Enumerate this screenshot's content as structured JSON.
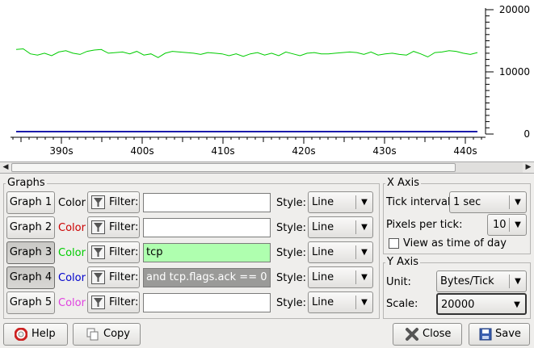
{
  "plot": {
    "y_ticks": [
      "20000",
      "10000",
      "0"
    ],
    "x_ticks": [
      "390s",
      "400s",
      "410s",
      "420s",
      "430s",
      "440s"
    ],
    "series_color": "#00cc00",
    "baseline_color": "#1a1aaa",
    "series_values": [
      13600,
      13700,
      12900,
      12700,
      13000,
      12600,
      13200,
      13400,
      13000,
      12800,
      13300,
      13500,
      13600,
      13000,
      13100,
      13200,
      12900,
      13300,
      12700,
      12900,
      12300,
      13000,
      13300,
      13200,
      13100,
      13000,
      12800,
      13100,
      13000,
      12900,
      12600,
      12900,
      12500,
      12900,
      13100,
      12700,
      13000,
      12600,
      13200,
      12900,
      12600,
      13000,
      13100,
      12900,
      12900,
      13000,
      13100,
      13200,
      13100,
      12800,
      13200,
      12700,
      12900,
      13000,
      12800,
      12700,
      13300,
      12900,
      12400,
      13100,
      13200,
      13400,
      13300,
      13000,
      12800,
      13100
    ]
  },
  "graphs": {
    "title": "Graphs",
    "color_label": "Color",
    "filter_label": "Filter:",
    "style_label": "Style:",
    "rows": [
      {
        "name": "Graph 1",
        "color": "",
        "color_hex": "#000000",
        "filter": "",
        "style": "Line",
        "pressed": false,
        "field": "plain"
      },
      {
        "name": "Graph 2",
        "color": "",
        "color_hex": "#cc0000",
        "filter": "",
        "style": "Line",
        "pressed": false,
        "field": "plain"
      },
      {
        "name": "Graph 3",
        "color": "",
        "color_hex": "#00cc00",
        "filter": "tcp",
        "style": "Line",
        "pressed": true,
        "field": "green"
      },
      {
        "name": "Graph 4",
        "color": "",
        "color_hex": "#0000cc",
        "filter": " and tcp.flags.ack == 0",
        "style": "Line",
        "pressed": true,
        "field": "grey"
      },
      {
        "name": "Graph 5",
        "color": "",
        "color_hex": "#e040e0",
        "filter": "",
        "style": "Line",
        "pressed": false,
        "field": "plain"
      }
    ]
  },
  "x_axis": {
    "title": "X Axis",
    "tick_interval_label": "Tick interval:",
    "tick_interval_value": "1 sec",
    "pixels_per_tick_label": "Pixels per tick:",
    "pixels_per_tick_value": "10",
    "view_time_of_day_label": "View as time of day",
    "view_time_of_day_checked": false
  },
  "y_axis": {
    "title": "Y Axis",
    "unit_label": "Unit:",
    "unit_value": "Bytes/Tick",
    "scale_label": "Scale:",
    "scale_value": "20000"
  },
  "buttons": {
    "help": "Help",
    "copy": "Copy",
    "close": "Close",
    "save": "Save"
  }
}
